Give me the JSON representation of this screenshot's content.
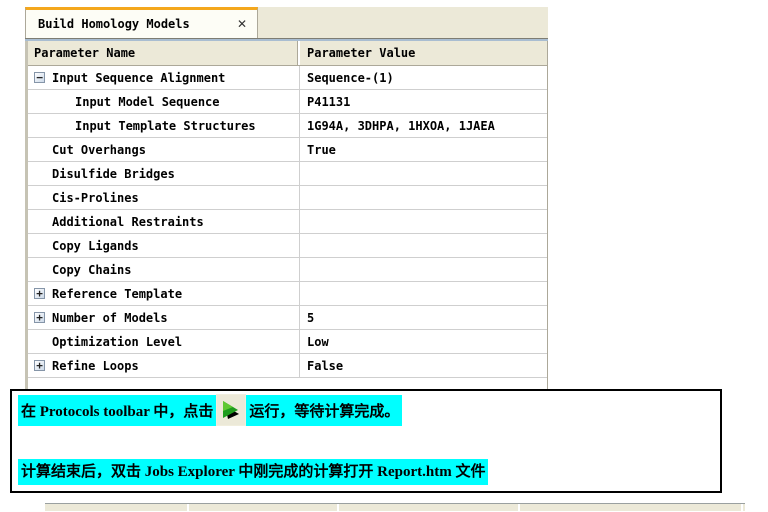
{
  "tab": {
    "title": "Build Homology Models",
    "close_glyph": "✕"
  },
  "table": {
    "columns": {
      "name": "Parameter Name",
      "value": "Parameter Value"
    },
    "rows": [
      {
        "name": "Input Sequence Alignment",
        "value": "Sequence-(1)",
        "expander": "−"
      },
      {
        "name": "Input Model Sequence",
        "value": "P41131",
        "expander": ""
      },
      {
        "name": "Input Template Structures",
        "value": "1G94A, 3DHPA, 1HXOA, 1JAEA",
        "expander": ""
      },
      {
        "name": "Cut Overhangs",
        "value": "True",
        "expander": ""
      },
      {
        "name": "Disulfide Bridges",
        "value": "",
        "expander": ""
      },
      {
        "name": "Cis-Prolines",
        "value": "",
        "expander": ""
      },
      {
        "name": "Additional Restraints",
        "value": "",
        "expander": ""
      },
      {
        "name": "Copy Ligands",
        "value": "",
        "expander": ""
      },
      {
        "name": "Copy Chains",
        "value": "",
        "expander": ""
      },
      {
        "name": "Reference Template",
        "value": "",
        "expander": "+"
      },
      {
        "name": "Number of Models",
        "value": "5",
        "expander": "+"
      },
      {
        "name": "Optimization Level",
        "value": "Low",
        "expander": ""
      },
      {
        "name": "Refine Loops",
        "value": "False",
        "expander": "+"
      }
    ]
  },
  "instructions": {
    "line1_pre": "在  Protocols toolbar 中，点击",
    "line1_post": "运行，等待计算完成。",
    "line2": "计算结束后，双击  Jobs Explorer 中刚完成的计算打开 Report.htm  文件",
    "run_icon": "green-play-icon"
  },
  "colors": {
    "highlight_cyan": "#00ffff",
    "tab_accent_orange": "#f4a71d",
    "header_beige": "#ece9d8",
    "play_green": "#1e9c1e",
    "strip_blue": "#a9bdd1"
  }
}
